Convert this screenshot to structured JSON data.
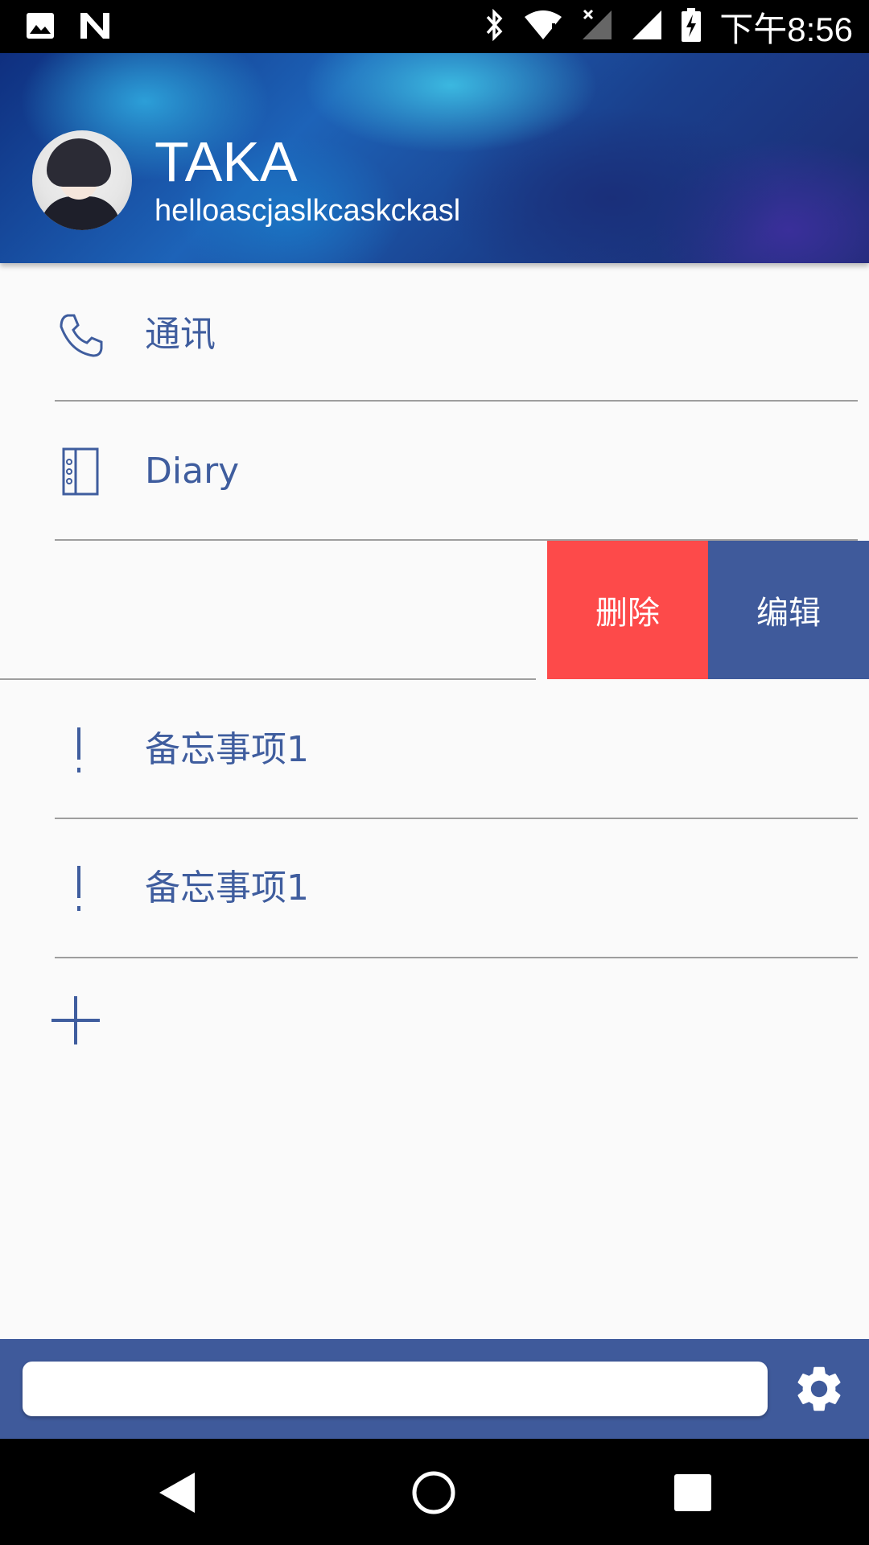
{
  "status_bar": {
    "time": "下午8:56",
    "icons": [
      "image-icon",
      "n-icon",
      "bluetooth-icon",
      "wifi-icon",
      "no-sim-icon",
      "signal-icon",
      "battery-charging-icon"
    ]
  },
  "header": {
    "user_name": "TAKA",
    "user_email": "helloascjaslkcaskckasl"
  },
  "list": {
    "items": [
      {
        "icon": "phone-icon",
        "label": "通讯"
      },
      {
        "icon": "notebook-icon",
        "label": "Diary"
      },
      {
        "icon": "exclamation-icon",
        "label": "备忘事项1"
      },
      {
        "icon": "exclamation-icon",
        "label": "备忘事项1"
      }
    ],
    "swipe_actions": {
      "delete_label": "删除",
      "edit_label": "编辑"
    },
    "add_icon": "plus-icon"
  },
  "input_bar": {
    "value": "",
    "placeholder": "",
    "settings_icon": "gear-icon"
  },
  "nav_bar": {
    "icons": [
      "back-icon",
      "home-icon",
      "recents-icon"
    ]
  },
  "colors": {
    "accent": "#3f5a9b",
    "label": "#3f5d9e",
    "delete": "#fd4a4a",
    "background": "#fafafa"
  }
}
